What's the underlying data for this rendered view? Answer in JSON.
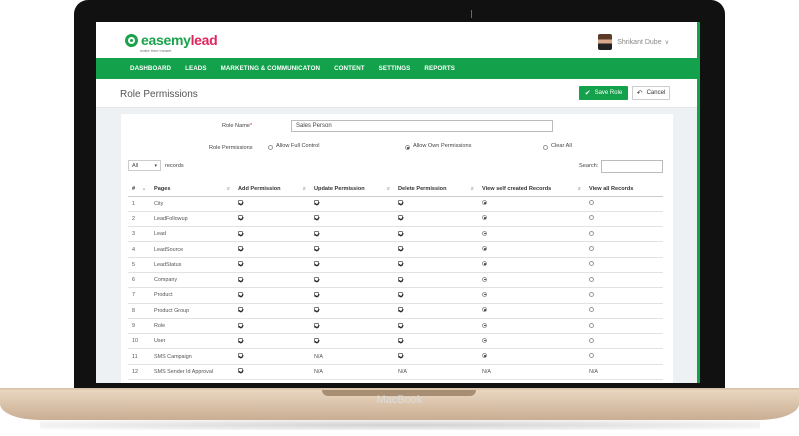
{
  "device": {
    "brand": "MacBook"
  },
  "header": {
    "logo": {
      "brand_main": "easemy",
      "brand_accent": "lead",
      "tagline": "make time instant"
    },
    "user_name": "Shrikant Dube",
    "user_caret": "∨"
  },
  "nav": {
    "items": [
      "DASHBOARD",
      "LEADS",
      "MARKETING & COMMUNICATON",
      "CONTENT",
      "SETTINGS",
      "REPORTS"
    ]
  },
  "page": {
    "title": "Role Permissions",
    "save_label": "Save Role",
    "cancel_label": "Cancel"
  },
  "form": {
    "role_name_label": "Role Name",
    "role_name_required": "*",
    "role_name_value": "Sales Person",
    "permissions_label": "Role Permissions",
    "options": [
      {
        "label": "Allow Full Control",
        "selected": false
      },
      {
        "label": "Allow Own Permissions",
        "selected": true
      },
      {
        "label": "Clear All",
        "selected": false
      }
    ]
  },
  "table_controls": {
    "page_size": "All",
    "records_label": "records",
    "search_label": "Search:"
  },
  "table": {
    "headers": [
      "#",
      "Pages",
      "Add Permission",
      "Update Permission",
      "Delete Permission",
      "View self created Records",
      "View all Records"
    ],
    "rows": [
      {
        "num": "1",
        "page": "City",
        "add": "check",
        "update": "check",
        "delete": "check",
        "self": "radio-on",
        "all": "radio-off"
      },
      {
        "num": "2",
        "page": "LeadFollowup",
        "add": "check",
        "update": "check",
        "delete": "check",
        "self": "radio-on",
        "all": "radio-off"
      },
      {
        "num": "3",
        "page": "Lead",
        "add": "check",
        "update": "check",
        "delete": "check",
        "self": "radio-on",
        "all": "radio-off"
      },
      {
        "num": "4",
        "page": "LeadSource",
        "add": "check",
        "update": "check",
        "delete": "check",
        "self": "radio-on",
        "all": "radio-off"
      },
      {
        "num": "5",
        "page": "LeadStatus",
        "add": "check",
        "update": "check",
        "delete": "check",
        "self": "radio-on",
        "all": "radio-off"
      },
      {
        "num": "6",
        "page": "Company",
        "add": "check",
        "update": "check",
        "delete": "check",
        "self": "radio-on",
        "all": "radio-off"
      },
      {
        "num": "7",
        "page": "Product",
        "add": "check",
        "update": "check",
        "delete": "check",
        "self": "radio-on",
        "all": "radio-off"
      },
      {
        "num": "8",
        "page": "Product Group",
        "add": "check",
        "update": "check",
        "delete": "check",
        "self": "radio-on",
        "all": "radio-off"
      },
      {
        "num": "9",
        "page": "Role",
        "add": "check",
        "update": "check",
        "delete": "check",
        "self": "radio-on",
        "all": "radio-off"
      },
      {
        "num": "10",
        "page": "User",
        "add": "check",
        "update": "check",
        "delete": "check",
        "self": "radio-on",
        "all": "radio-off"
      },
      {
        "num": "11",
        "page": "SMS Campaign",
        "add": "check",
        "update": "N/A",
        "delete": "check",
        "self": "radio-on",
        "all": "radio-off"
      },
      {
        "num": "12",
        "page": "SMS Sender Id Approval",
        "add": "check",
        "update": "N/A",
        "delete": "N/A",
        "self": "N/A",
        "all": "N/A"
      }
    ]
  },
  "colors": {
    "brand_green": "#13a14b",
    "accent_pink": "#e0245e"
  }
}
